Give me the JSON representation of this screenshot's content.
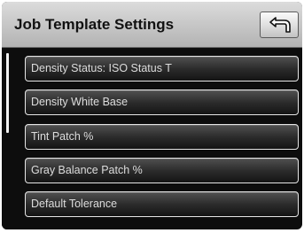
{
  "header": {
    "title": "Job Template Settings",
    "back_icon": "back-arrow-icon"
  },
  "menu": {
    "items": [
      {
        "label": "Density Status: ISO Status T"
      },
      {
        "label": "Density White Base"
      },
      {
        "label": "Tint Patch %"
      },
      {
        "label": "Gray Balance Patch %"
      },
      {
        "label": "Default Tolerance"
      }
    ]
  },
  "colors": {
    "background": "#0d0d0d",
    "header": "#c9c9c9",
    "button_border": "#e6e6e6",
    "text": "#dddddd"
  }
}
